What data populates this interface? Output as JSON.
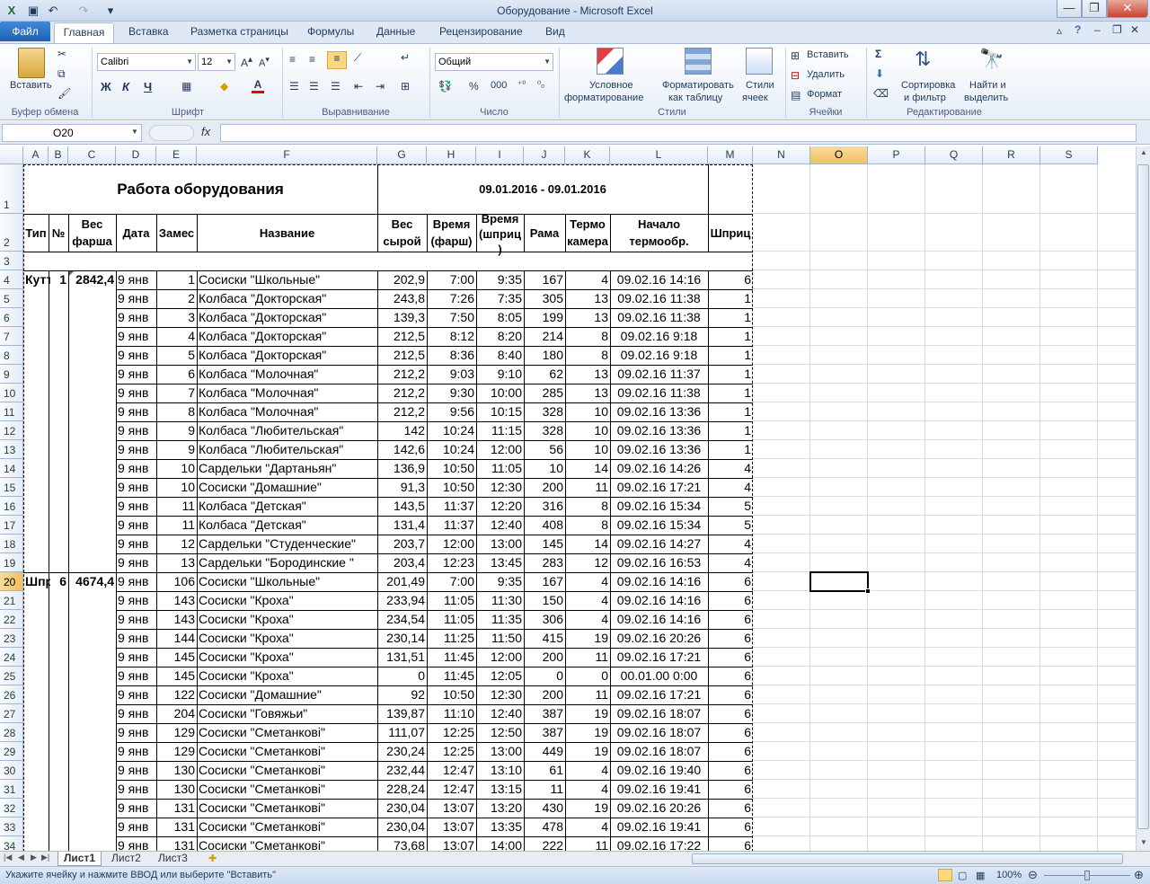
{
  "window": {
    "title": "Оборудование  -  Microsoft Excel"
  },
  "tabs": [
    "Файл",
    "Главная",
    "Вставка",
    "Разметка страницы",
    "Формулы",
    "Данные",
    "Рецензирование",
    "Вид"
  ],
  "ribbon": {
    "clipboard": {
      "paste": "Вставить",
      "group": "Буфер обмена"
    },
    "font": {
      "name": "Calibri",
      "size": "12",
      "bold": "Ж",
      "italic": "К",
      "underline": "Ч",
      "group": "Шрифт"
    },
    "alignment": {
      "group": "Выравнивание"
    },
    "number": {
      "format": "Общий",
      "group": "Число",
      "percent": "%",
      "thousands": "000"
    },
    "styles": {
      "conditional": "Условное",
      "conditional2": "форматирование",
      "astable": "Форматировать",
      "astable2": "как таблицу",
      "cellstyles": "Стили",
      "cellstyles2": "ячеек",
      "group": "Стили"
    },
    "cells": {
      "insert": "Вставить",
      "delete": "Удалить",
      "format": "Формат",
      "group": "Ячейки"
    },
    "editing": {
      "sort": "Сортировка",
      "sort2": "и фильтр",
      "find": "Найти и",
      "find2": "выделить",
      "group": "Редактирование"
    }
  },
  "formula_bar": {
    "name_box": "O20",
    "fx": "fx",
    "content": ""
  },
  "columns": [
    "A",
    "B",
    "C",
    "D",
    "E",
    "F",
    "G",
    "H",
    "I",
    "J",
    "K",
    "L",
    "M",
    "N",
    "O",
    "P",
    "Q",
    "R",
    "S"
  ],
  "rows_visible": [
    "1",
    "2",
    "3",
    "4",
    "5",
    "6",
    "7",
    "8",
    "9",
    "10",
    "11",
    "12",
    "13",
    "14",
    "15",
    "16",
    "17",
    "18",
    "19",
    "20",
    "21",
    "22",
    "23",
    "24",
    "25",
    "26",
    "27",
    "28",
    "29",
    "30",
    "31",
    "32",
    "33",
    "34"
  ],
  "sheet": {
    "title": "Работа оборудования",
    "period": "09.01.2016 - 09.01.2016",
    "headers": {
      "type": "Тип",
      "num": "№",
      "wt1": "Вес",
      "wt2": "фарша",
      "date": "Дата",
      "batch": "Замес",
      "name": "Название",
      "raw1": "Вес",
      "raw2": "сырой",
      "t1a": "Время",
      "t1b": "(фарш)",
      "t2a": "Время",
      "t2b": "(шприц",
      "t2c": ")",
      "frame": "Рама",
      "tc1": "Термо",
      "tc2": "камера",
      "st1": "Начало",
      "st2": "термообр.",
      "syr": "Шприц"
    },
    "groups": [
      {
        "row": 0,
        "type": "Куттер",
        "num": "1",
        "weight": "2842,4"
      },
      {
        "row": 16,
        "type": "Шприц",
        "num": "6",
        "weight": "4674,4"
      }
    ],
    "rows": [
      [
        "9 янв",
        "1",
        "Сосиски \"Школьные\"",
        "202,9",
        "7:00",
        "9:35",
        "167",
        "4",
        "09.02.16 14:16",
        "6"
      ],
      [
        "9 янв",
        "2",
        "Колбаса \"Докторская\"",
        "243,8",
        "7:26",
        "7:35",
        "305",
        "13",
        "09.02.16 11:38",
        "1"
      ],
      [
        "9 янв",
        "3",
        "Колбаса \"Докторская\"",
        "139,3",
        "7:50",
        "8:05",
        "199",
        "13",
        "09.02.16 11:38",
        "1"
      ],
      [
        "9 янв",
        "4",
        "Колбаса \"Докторская\"",
        "212,5",
        "8:12",
        "8:20",
        "214",
        "8",
        "09.02.16 9:18",
        "1"
      ],
      [
        "9 янв",
        "5",
        "Колбаса \"Докторская\"",
        "212,5",
        "8:36",
        "8:40",
        "180",
        "8",
        "09.02.16 9:18",
        "1"
      ],
      [
        "9 янв",
        "6",
        "Колбаса \"Молочная\"",
        "212,2",
        "9:03",
        "9:10",
        "62",
        "13",
        "09.02.16 11:37",
        "1"
      ],
      [
        "9 янв",
        "7",
        "Колбаса \"Молочная\"",
        "212,2",
        "9:30",
        "10:00",
        "285",
        "13",
        "09.02.16 11:38",
        "1"
      ],
      [
        "9 янв",
        "8",
        "Колбаса \"Молочная\"",
        "212,2",
        "9:56",
        "10:15",
        "328",
        "10",
        "09.02.16 13:36",
        "1"
      ],
      [
        "9 янв",
        "9",
        "Колбаса \"Любительская\"",
        "142",
        "10:24",
        "11:15",
        "328",
        "10",
        "09.02.16 13:36",
        "1"
      ],
      [
        "9 янв",
        "9",
        "Колбаса \"Любительская\"",
        "142,6",
        "10:24",
        "12:00",
        "56",
        "10",
        "09.02.16 13:36",
        "1"
      ],
      [
        "9 янв",
        "10",
        "Сардельки \"Дартаньян\"",
        "136,9",
        "10:50",
        "11:05",
        "10",
        "14",
        "09.02.16 14:26",
        "4"
      ],
      [
        "9 янв",
        "10",
        "Сосиски \"Домашние\"",
        "91,3",
        "10:50",
        "12:30",
        "200",
        "11",
        "09.02.16 17:21",
        "4"
      ],
      [
        "9 янв",
        "11",
        "Колбаса \"Детская\"",
        "143,5",
        "11:37",
        "12:20",
        "316",
        "8",
        "09.02.16 15:34",
        "5"
      ],
      [
        "9 янв",
        "11",
        "Колбаса \"Детская\"",
        "131,4",
        "11:37",
        "12:40",
        "408",
        "8",
        "09.02.16 15:34",
        "5"
      ],
      [
        "9 янв",
        "12",
        "Сардельки \"Студенческие\"",
        "203,7",
        "12:00",
        "13:00",
        "145",
        "14",
        "09.02.16 14:27",
        "4"
      ],
      [
        "9 янв",
        "13",
        "Сардельки \"Бородинские \"",
        "203,4",
        "12:23",
        "13:45",
        "283",
        "12",
        "09.02.16 16:53",
        "4"
      ],
      [
        "9 янв",
        "106",
        "Сосиски \"Школьные\"",
        "201,49",
        "7:00",
        "9:35",
        "167",
        "4",
        "09.02.16 14:16",
        "6"
      ],
      [
        "9 янв",
        "143",
        "Сосиски \"Кроха\"",
        "233,94",
        "11:05",
        "11:30",
        "150",
        "4",
        "09.02.16 14:16",
        "6"
      ],
      [
        "9 янв",
        "143",
        "Сосиски \"Кроха\"",
        "234,54",
        "11:05",
        "11:35",
        "306",
        "4",
        "09.02.16 14:16",
        "6"
      ],
      [
        "9 янв",
        "144",
        "Сосиски \"Кроха\"",
        "230,14",
        "11:25",
        "11:50",
        "415",
        "19",
        "09.02.16 20:26",
        "6"
      ],
      [
        "9 янв",
        "145",
        "Сосиски \"Кроха\"",
        "131,51",
        "11:45",
        "12:00",
        "200",
        "11",
        "09.02.16 17:21",
        "6"
      ],
      [
        "9 янв",
        "145",
        "Сосиски \"Кроха\"",
        "0",
        "11:45",
        "12:05",
        "0",
        "0",
        "00.01.00 0:00",
        "6"
      ],
      [
        "9 янв",
        "122",
        "Сосиски \"Домашние\"",
        "92",
        "10:50",
        "12:30",
        "200",
        "11",
        "09.02.16 17:21",
        "6"
      ],
      [
        "9 янв",
        "204",
        "Сосиски \"Говяжьи\"",
        "139,87",
        "11:10",
        "12:40",
        "387",
        "19",
        "09.02.16 18:07",
        "6"
      ],
      [
        "9 янв",
        "129",
        "Сосиски \"Сметанкові\"",
        "111,07",
        "12:25",
        "12:50",
        "387",
        "19",
        "09.02.16 18:07",
        "6"
      ],
      [
        "9 янв",
        "129",
        "Сосиски \"Сметанкові\"",
        "230,24",
        "12:25",
        "13:00",
        "449",
        "19",
        "09.02.16 18:07",
        "6"
      ],
      [
        "9 янв",
        "130",
        "Сосиски \"Сметанкові\"",
        "232,44",
        "12:47",
        "13:10",
        "61",
        "4",
        "09.02.16 19:40",
        "6"
      ],
      [
        "9 янв",
        "130",
        "Сосиски \"Сметанкові\"",
        "228,24",
        "12:47",
        "13:15",
        "11",
        "4",
        "09.02.16 19:41",
        "6"
      ],
      [
        "9 янв",
        "131",
        "Сосиски \"Сметанкові\"",
        "230,04",
        "13:07",
        "13:20",
        "430",
        "19",
        "09.02.16 20:26",
        "6"
      ],
      [
        "9 янв",
        "131",
        "Сосиски \"Сметанкові\"",
        "230,04",
        "13:07",
        "13:35",
        "478",
        "4",
        "09.02.16 19:41",
        "6"
      ],
      [
        "9 янв",
        "131",
        "Сосиски \"Сметанкові\"",
        "73,68",
        "13:07",
        "14:00",
        "222",
        "11",
        "09.02.16 17:22",
        "6"
      ]
    ]
  },
  "sheet_tabs": [
    "Лист1",
    "Лист2",
    "Лист3"
  ],
  "status": {
    "message": "Укажите ячейку и нажмите ВВОД или выберите \"Вставить\"",
    "zoom": "100%"
  }
}
